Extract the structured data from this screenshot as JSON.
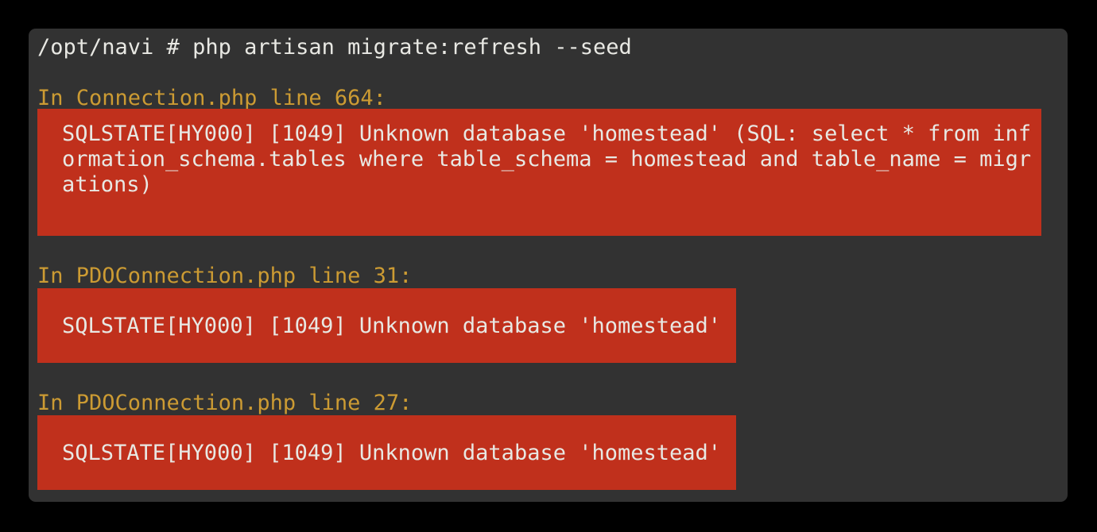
{
  "terminal": {
    "background_color": "#323232",
    "page_background_color": "#000000",
    "text_color": "#e8e8e3",
    "heading_color": "#cc9b33",
    "error_block_color": "#c0301c",
    "prompt_line": "/opt/navi # php artisan migrate:refresh --seed",
    "errors": [
      {
        "heading": "In Connection.php line 664:",
        "lines": [
          "SQLSTATE[HY000] [1049] Unknown database 'homestead' (SQL: select * from inf",
          "ormation_schema.tables where table_schema = homestead and table_name = migr",
          "ations)"
        ]
      },
      {
        "heading": "In PDOConnection.php line 31:",
        "lines": [
          "SQLSTATE[HY000] [1049] Unknown database 'homestead'"
        ]
      },
      {
        "heading": "In PDOConnection.php line 27:",
        "lines": [
          "SQLSTATE[HY000] [1049] Unknown database 'homestead'"
        ]
      }
    ]
  }
}
